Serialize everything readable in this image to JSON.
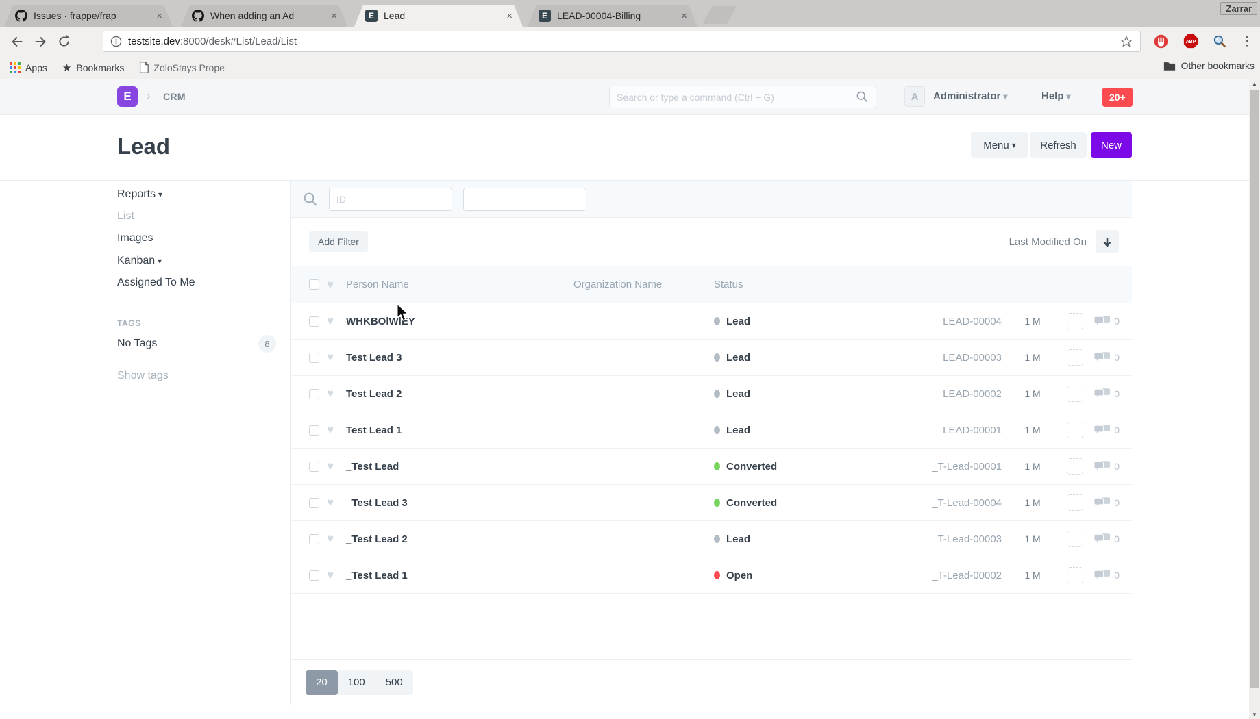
{
  "browser": {
    "window_label": "Zarrar",
    "tabs": [
      {
        "title": "Issues · frappe/frap",
        "favicon": "github",
        "active": false
      },
      {
        "title": "When adding an Ad",
        "favicon": "github",
        "active": false
      },
      {
        "title": "Lead",
        "favicon": "erpnext",
        "active": true
      },
      {
        "title": "LEAD-00004-Billing",
        "favicon": "erpnext",
        "active": false
      }
    ],
    "favicon_letter": "E",
    "url": {
      "host": "testsite.dev",
      "rest": ":8000/desk#List/Lead/List"
    },
    "bookmarks": {
      "apps_label": "Apps",
      "bookmarks_label": "Bookmarks",
      "bookmark_item": "ZoloStays Prope",
      "other_bookmarks_label": "Other bookmarks"
    },
    "extensions": {
      "adblock_label": "ABP"
    }
  },
  "navbar": {
    "app_label": "CRM",
    "search_placeholder": "Search or type a command (Ctrl + G)",
    "avatar_letter": "A",
    "user_label": "Administrator",
    "help_label": "Help",
    "notification_count": "20+"
  },
  "page": {
    "title": "Lead",
    "menu_label": "Menu",
    "refresh_label": "Refresh",
    "new_label": "New"
  },
  "sidebar": {
    "reports_label": "Reports",
    "list_label": "List",
    "images_label": "Images",
    "kanban_label": "Kanban",
    "assigned_label": "Assigned To Me",
    "tags_heading": "TAGS",
    "no_tags_label": "No Tags",
    "no_tags_count": "8",
    "show_tags_label": "Show tags"
  },
  "filters": {
    "id_placeholder": "ID",
    "add_filter_label": "Add Filter",
    "sort_field": "Last Modified On"
  },
  "table": {
    "columns": {
      "name": "Person Name",
      "org": "Organization Name",
      "status": "Status"
    },
    "rows": [
      {
        "name": "WHKBOlWlEY",
        "org": "",
        "status": "Lead",
        "dot": "#b4bcc6",
        "id": "LEAD-00004",
        "modified": "1 M",
        "comments": "0"
      },
      {
        "name": "Test Lead 3",
        "org": "",
        "status": "Lead",
        "dot": "#b4bcc6",
        "id": "LEAD-00003",
        "modified": "1 M",
        "comments": "0"
      },
      {
        "name": "Test Lead 2",
        "org": "",
        "status": "Lead",
        "dot": "#b4bcc6",
        "id": "LEAD-00002",
        "modified": "1 M",
        "comments": "0"
      },
      {
        "name": "Test Lead 1",
        "org": "",
        "status": "Lead",
        "dot": "#b4bcc6",
        "id": "LEAD-00001",
        "modified": "1 M",
        "comments": "0"
      },
      {
        "name": "_Test Lead",
        "org": "",
        "status": "Converted",
        "dot": "#77d55f",
        "id": "_T-Lead-00001",
        "modified": "1 M",
        "comments": "0"
      },
      {
        "name": "_Test Lead 3",
        "org": "",
        "status": "Converted",
        "dot": "#77d55f",
        "id": "_T-Lead-00004",
        "modified": "1 M",
        "comments": "0"
      },
      {
        "name": "_Test Lead 2",
        "org": "",
        "status": "Lead",
        "dot": "#b4bcc6",
        "id": "_T-Lead-00003",
        "modified": "1 M",
        "comments": "0"
      },
      {
        "name": "_Test Lead 1",
        "org": "",
        "status": "Open",
        "dot": "#fb4a51",
        "id": "_T-Lead-00002",
        "modified": "1 M",
        "comments": "0"
      }
    ]
  },
  "pagination": {
    "options": [
      "20",
      "100",
      "500"
    ],
    "selected": "20"
  },
  "icons": {
    "close": "×",
    "caret_down": "▾",
    "chevron_right": "›",
    "heart": "♥",
    "star": "★",
    "dots_menu": "⋮",
    "up": "▲",
    "down": "▼"
  },
  "colors": {
    "accent_purple": "#7b09e8",
    "brand_purple": "#8746e0",
    "notification_red": "#fb4b51",
    "status_gray": "#b4bcc6",
    "status_green": "#77d55f",
    "status_red": "#fb4a51",
    "selected_page_bg": "#8d99a6"
  }
}
